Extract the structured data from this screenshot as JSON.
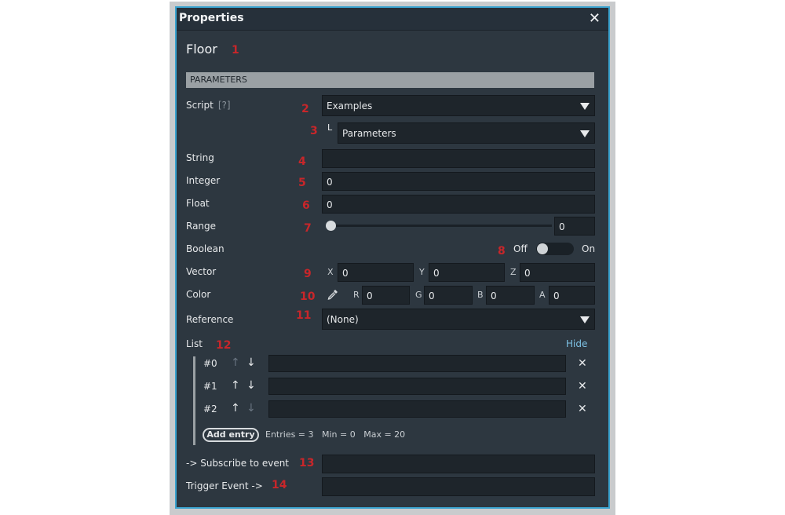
{
  "window": {
    "title": "Properties",
    "close_glyph": "✕"
  },
  "object_name": "Floor",
  "section_title": "PARAMETERS",
  "annotations": [
    "1",
    "2",
    "3",
    "4",
    "5",
    "6",
    "7",
    "8",
    "9",
    "10",
    "11",
    "12",
    "13",
    "14"
  ],
  "script": {
    "label": "Script",
    "help": "[?]",
    "value": "Examples",
    "sub_prefix": "L",
    "sub_value": "Parameters"
  },
  "fields": {
    "string": {
      "label": "String",
      "value": ""
    },
    "integer": {
      "label": "Integer",
      "value": "0"
    },
    "float": {
      "label": "Float",
      "value": "0"
    },
    "range": {
      "label": "Range",
      "value": "0",
      "level": 0
    },
    "boolean": {
      "label": "Boolean",
      "off": "Off",
      "on": "On",
      "state": false
    },
    "vector": {
      "label": "Vector",
      "x_label": "X",
      "x": "0",
      "y_label": "Y",
      "y": "0",
      "z_label": "Z",
      "z": "0"
    },
    "color": {
      "label": "Color",
      "icon": "eyedropper-icon",
      "r_label": "R",
      "r": "0",
      "g_label": "G",
      "g": "0",
      "b_label": "B",
      "b": "0",
      "a_label": "A",
      "a": "0"
    },
    "reference": {
      "label": "Reference",
      "value": "(None)"
    }
  },
  "list": {
    "label": "List",
    "hide": "Hide",
    "items": [
      {
        "index": "#0",
        "value": ""
      },
      {
        "index": "#1",
        "value": ""
      },
      {
        "index": "#2",
        "value": ""
      }
    ],
    "up_glyph": "↑",
    "down_glyph": "↓",
    "remove_glyph": "✕",
    "add_label": "Add entry",
    "stats": "Entries = 3   Min = 0   Max = 20"
  },
  "events": {
    "subscribe_label": "->  Subscribe to event",
    "subscribe_value": "",
    "trigger_label": "Trigger  Event ->",
    "trigger_value": ""
  },
  "colors": {
    "accent": "#3aa3cf",
    "annotation": "#c8262a",
    "panel": "#2d3740",
    "link": "#7ec3e6"
  }
}
